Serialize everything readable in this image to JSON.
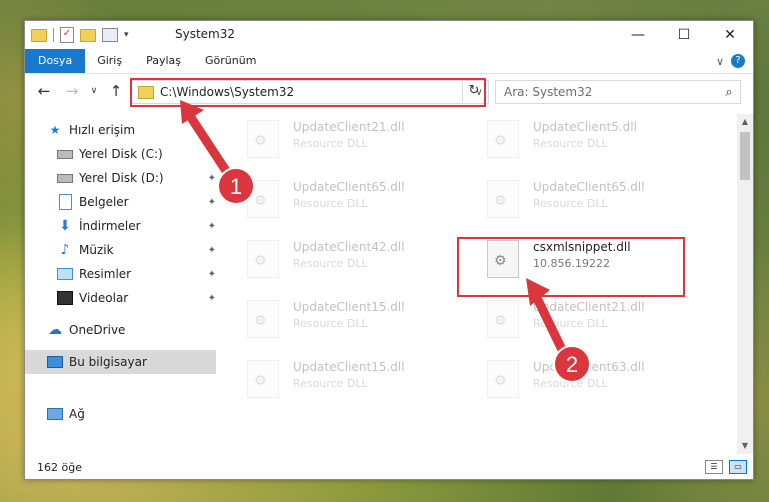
{
  "window": {
    "title": "System32",
    "controls": {
      "minimize": "—",
      "maximize": "☐",
      "close": "✕"
    }
  },
  "ribbon": {
    "tabs": [
      {
        "label": "Dosya",
        "active": true
      },
      {
        "label": "Giriş"
      },
      {
        "label": "Paylaş"
      },
      {
        "label": "Görünüm"
      }
    ],
    "expand": "∨",
    "help": "?"
  },
  "nav": {
    "back": "←",
    "forward": "→",
    "recent": "∨",
    "up": "↑",
    "address": "C:\\Windows\\System32",
    "address_drop": "∨",
    "refresh": "↻",
    "search_placeholder": "Ara: System32",
    "search_icon": "⌕"
  },
  "sidebar": {
    "quick_access": "Hızlı erişim",
    "items": [
      {
        "label": "Yerel Disk (C:)",
        "icon": "drive-icon"
      },
      {
        "label": "Yerel Disk (D:)",
        "icon": "drive-icon"
      },
      {
        "label": "Belgeler",
        "icon": "documents-icon"
      },
      {
        "label": "İndirmeler",
        "icon": "downloads-icon"
      },
      {
        "label": "Müzik",
        "icon": "music-icon"
      },
      {
        "label": "Resimler",
        "icon": "pictures-icon"
      },
      {
        "label": "Videolar",
        "icon": "videos-icon"
      }
    ],
    "onedrive": "OneDrive",
    "this_pc": "Bu bilgisayar",
    "network": "Ağ",
    "pin": "✦"
  },
  "files": [
    {
      "name": "UpdateClient21.dll",
      "sub": "Resource DLL",
      "faded": true
    },
    {
      "name": "UpdateClient5.dll",
      "sub": "Resource DLL",
      "faded": true
    },
    {
      "name": "UpdateClient65.dll",
      "sub": "Resource DLL",
      "faded": true
    },
    {
      "name": "UpdateClient65.dll",
      "sub": "Resource DLL",
      "faded": true
    },
    {
      "name": "UpdateClient42.dll",
      "sub": "Resource DLL",
      "faded": true
    },
    {
      "name": "csxmlsnippet.dll",
      "sub": "10.856.19222",
      "faded": false
    },
    {
      "name": "UpdateClient15.dll",
      "sub": "Resource DLL",
      "faded": true
    },
    {
      "name": "UpdateClient21.dll",
      "sub": "Resource DLL",
      "faded": true
    },
    {
      "name": "UpdateClient15.dll",
      "sub": "Resource DLL",
      "faded": true
    },
    {
      "name": "UpdateClient63.dll",
      "sub": "Resource DLL",
      "faded": true
    }
  ],
  "status": {
    "count": "162 öğe"
  },
  "callouts": [
    {
      "label": "1"
    },
    {
      "label": "2"
    }
  ],
  "colors": {
    "accent": "#1979ca",
    "highlight": "#d9363e",
    "selection": "#d9d9d9"
  }
}
